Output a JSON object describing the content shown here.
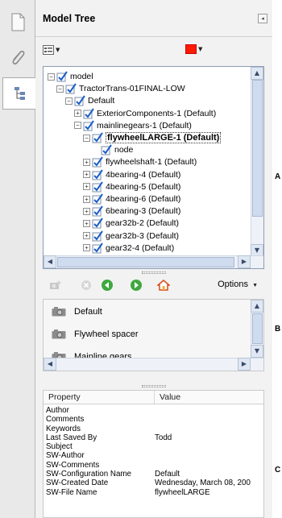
{
  "panel": {
    "title": "Model Tree",
    "collapse_glyph": "◂",
    "color_swatch": "#ff1a00"
  },
  "strip": {
    "icons": [
      "pages-icon",
      "attachment-icon",
      "model-tree-icon"
    ]
  },
  "tree": {
    "rows": [
      {
        "label": "model",
        "indent": 0,
        "expander": "−",
        "checked": true
      },
      {
        "label": "TractorTrans-01FINAL-LOW",
        "indent": 1,
        "expander": "−",
        "checked": true
      },
      {
        "label": "Default",
        "indent": 2,
        "expander": "−",
        "checked": true
      },
      {
        "label": "ExteriorComponents-1 (Default)",
        "indent": 3,
        "expander": "+",
        "checked": true
      },
      {
        "label": "mainlinegears-1 (Default)",
        "indent": 3,
        "expander": "−",
        "checked": true
      },
      {
        "label": "flywheelLARGE-1 (Default)",
        "indent": 4,
        "expander": "−",
        "checked": true,
        "selected": true
      },
      {
        "label": "node",
        "indent": 5,
        "expander": "",
        "checked": true
      },
      {
        "label": "flywheelshaft-1 (Default)",
        "indent": 4,
        "expander": "+",
        "checked": true
      },
      {
        "label": "4bearing-4 (Default)",
        "indent": 4,
        "expander": "+",
        "checked": true
      },
      {
        "label": "4bearing-5 (Default)",
        "indent": 4,
        "expander": "+",
        "checked": true
      },
      {
        "label": "4bearing-6 (Default)",
        "indent": 4,
        "expander": "+",
        "checked": true
      },
      {
        "label": "6bearing-3 (Default)",
        "indent": 4,
        "expander": "+",
        "checked": true
      },
      {
        "label": "gear32b-2 (Default)",
        "indent": 4,
        "expander": "+",
        "checked": true
      },
      {
        "label": "gear32b-3 (Default)",
        "indent": 4,
        "expander": "+",
        "checked": true
      },
      {
        "label": "gear32-4 (Default)",
        "indent": 4,
        "expander": "+",
        "checked": true
      }
    ]
  },
  "views": {
    "options_label": "Options",
    "items": [
      "Default",
      "Flywheel spacer",
      "Mainline gears"
    ]
  },
  "properties": {
    "header_property": "Property",
    "header_value": "Value",
    "rows": [
      {
        "key": "Author",
        "value": ""
      },
      {
        "key": "Comments",
        "value": ""
      },
      {
        "key": "Keywords",
        "value": ""
      },
      {
        "key": "Last Saved By",
        "value": "Todd"
      },
      {
        "key": "Subject",
        "value": ""
      },
      {
        "key": "SW-Author",
        "value": ""
      },
      {
        "key": "SW-Comments",
        "value": ""
      },
      {
        "key": "SW-Configuration Name",
        "value": "Default"
      },
      {
        "key": "SW-Created Date",
        "value": "Wednesday, March 08, 200"
      },
      {
        "key": "SW-File Name",
        "value": "flywheelLARGE"
      }
    ]
  },
  "margin_labels": {
    "a": "A",
    "b": "B",
    "c": "C"
  }
}
